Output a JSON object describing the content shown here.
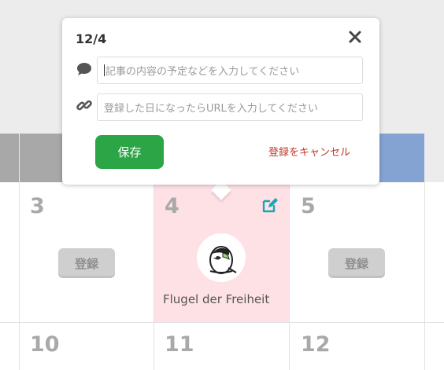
{
  "popup": {
    "date": "12/4",
    "memo_placeholder": "記事の内容の予定などを入力してください",
    "url_placeholder": "登録した日になったらURLを入力してください",
    "save_label": "保存",
    "cancel_label": "登録をキャンセル"
  },
  "calendar": {
    "days": [
      {
        "num": "3",
        "register_label": "登録"
      },
      {
        "num": "4",
        "event_name": "Flugel der Freiheit"
      },
      {
        "num": "5",
        "register_label": "登録"
      },
      {
        "num": "10"
      },
      {
        "num": "11"
      },
      {
        "num": "12"
      }
    ]
  },
  "colors": {
    "header_gray": "#a8a8a8",
    "header_blue": "#84a3d3",
    "today_bg": "#fde1e5",
    "accent_teal": "#18a8b5",
    "save_green": "#2ba546",
    "cancel_red": "#c0392b"
  },
  "icons": [
    "comment-icon",
    "link-icon",
    "close-icon",
    "edit-icon",
    "parrot-avatar"
  ]
}
